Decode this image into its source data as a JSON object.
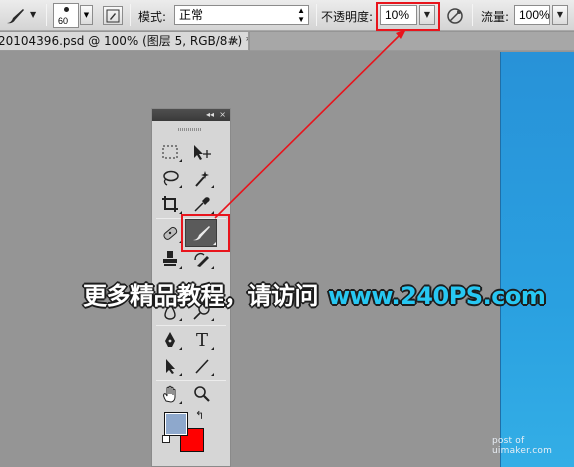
{
  "options_bar": {
    "brush_size": "60",
    "mode_label": "模式:",
    "mode_value": "正常",
    "opacity_label": "不透明度:",
    "opacity_value": "10%",
    "flow_label": "流量:",
    "flow_value": "100%"
  },
  "document_tab": {
    "title": "20104396.psd @ 100% (图层 5, RGB/8#) *",
    "close": "×"
  },
  "tools_panel": {
    "collapse_glyph": "◂◂",
    "close_glyph": "×",
    "type_tool_glyph": "T"
  },
  "colors": {
    "foreground": "#8ea8cc",
    "background": "#ff0000",
    "highlight": "#e8141c",
    "annotation_arrow": "#e8141c"
  },
  "caption": {
    "text": "更多精品教程，请访问",
    "url": "www.240PS.com"
  },
  "watermark": "post of uimaker.com"
}
